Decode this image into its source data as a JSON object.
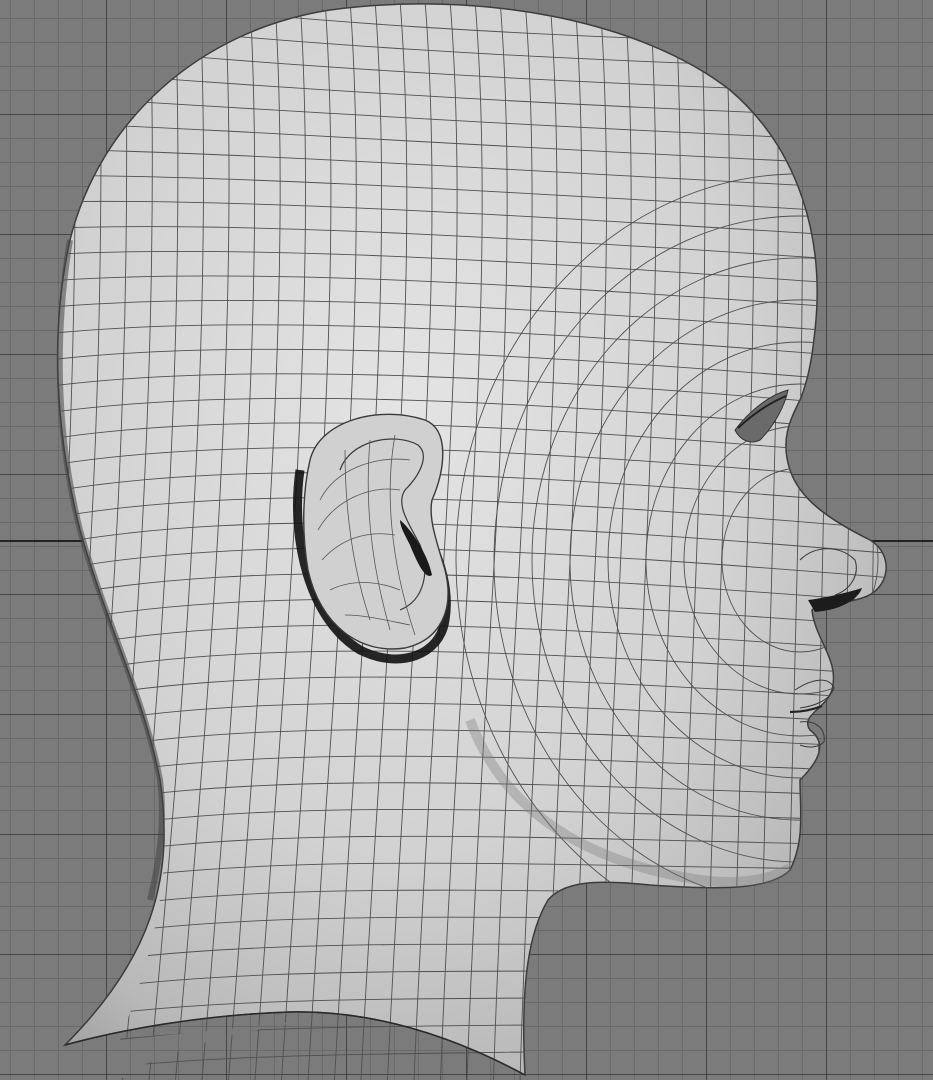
{
  "viewport": {
    "view": "side",
    "object": "head-mesh",
    "display_mode": "smooth-shaded-wireframe",
    "grid_visible": true,
    "colors": {
      "background": "#7b7b7b",
      "grid_major": "#3a3a3a",
      "grid_minor": "#5e5e5e",
      "mesh_fill": "#d9d9d9",
      "mesh_wire": "#4a4a4a",
      "origin_axis": "#222222"
    }
  }
}
